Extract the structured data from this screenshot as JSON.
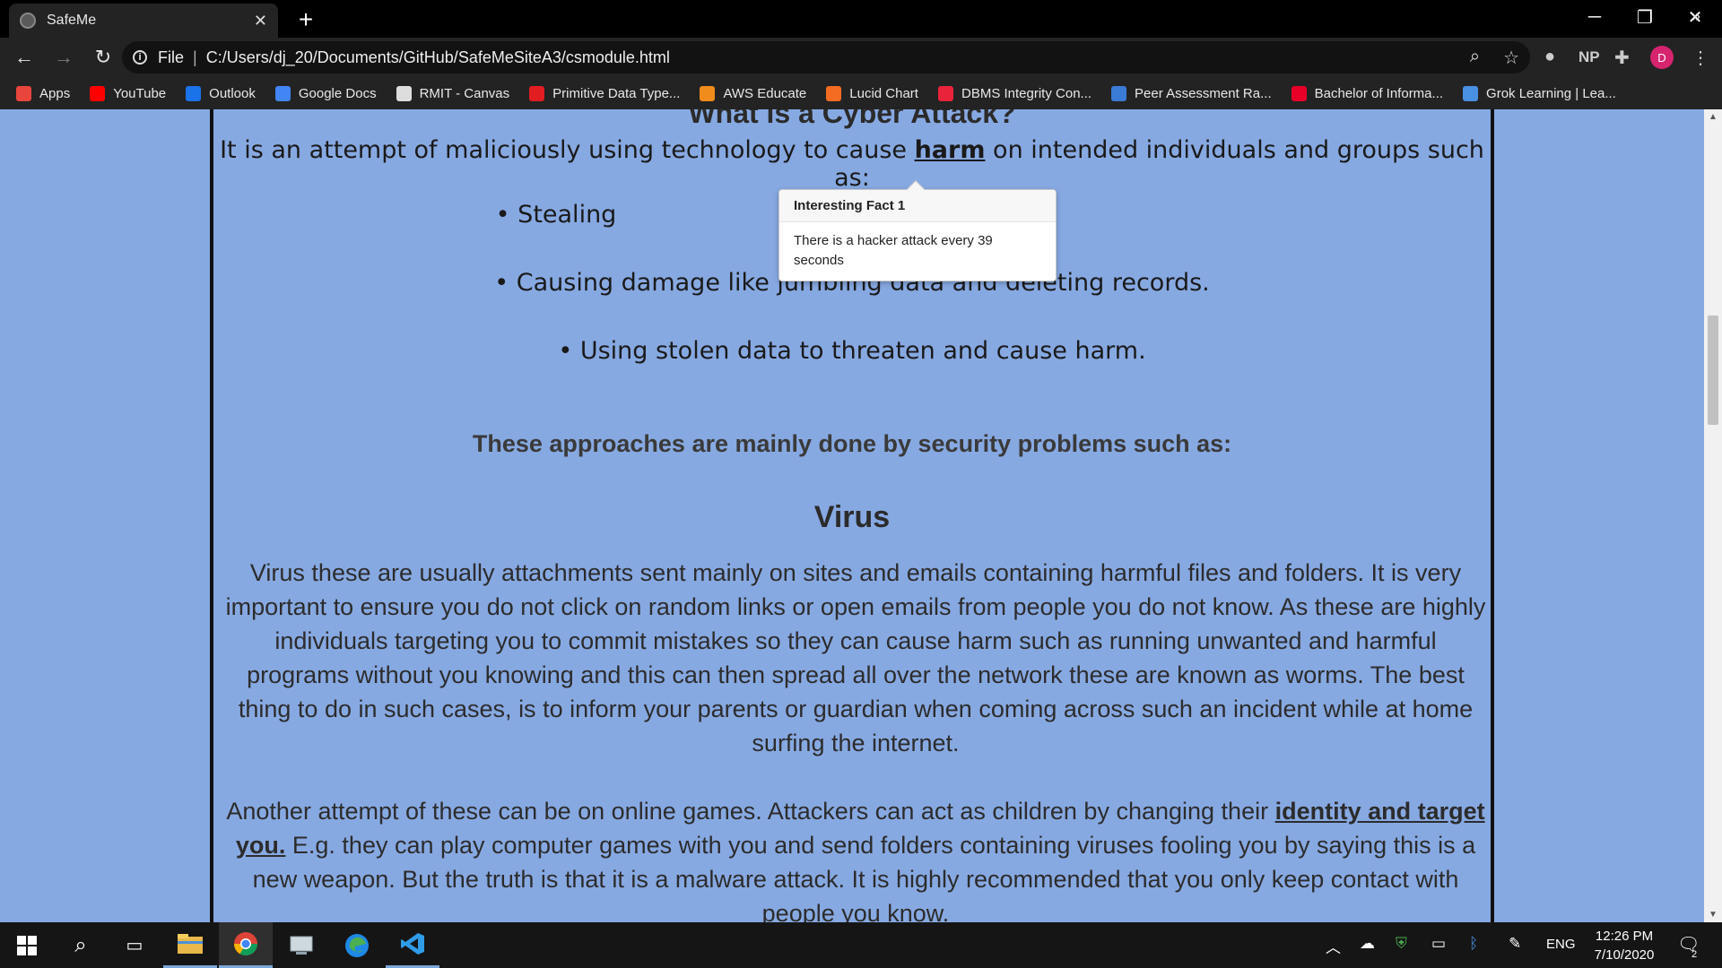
{
  "browser": {
    "tab_title": "SafeMe",
    "tab_close": "✕",
    "new_tab": "+",
    "window": {
      "minimize": "─",
      "restore": "❐",
      "close": "✕"
    },
    "address_scheme": "File",
    "address_url": "C:/Users/dj_20/Documents/GitHub/SafeMeSiteA3/csmodule.html",
    "profile_initial": "D",
    "extension_np": "NP",
    "bookmarks": [
      {
        "label": "Apps",
        "icon": "apps-grid-icon",
        "color": "#e8453c"
      },
      {
        "label": "YouTube",
        "icon": "youtube-icon",
        "color": "#ff0000"
      },
      {
        "label": "Outlook",
        "icon": "outlook-icon",
        "color": "#1a73e8"
      },
      {
        "label": "Google Docs",
        "icon": "google-docs-icon",
        "color": "#4285f4"
      },
      {
        "label": "RMIT - Canvas",
        "icon": "canvas-icon",
        "color": "#dddddd"
      },
      {
        "label": "Primitive Data Type...",
        "icon": "oracle-icon",
        "color": "#e11d21"
      },
      {
        "label": "AWS Educate",
        "icon": "aws-icon",
        "color": "#f08c1c"
      },
      {
        "label": "Lucid Chart",
        "icon": "lucidchart-icon",
        "color": "#f36c21"
      },
      {
        "label": "DBMS Integrity Con...",
        "icon": "dbms-icon",
        "color": "#e8233a"
      },
      {
        "label": "Peer Assessment Ra...",
        "icon": "peer-assessment-icon",
        "color": "#3a7bd5"
      },
      {
        "label": "Bachelor of Informa...",
        "icon": "rmit-icon",
        "color": "#e60028"
      },
      {
        "label": "Grok Learning | Lea...",
        "icon": "grok-icon",
        "color": "#4a90e2"
      }
    ],
    "bookmarks_more": "»"
  },
  "page": {
    "heading_clipped": "What is a Cyber Attack?",
    "lead_before": "It is an attempt of maliciously using technology to cause ",
    "lead_link": "harm",
    "lead_after": " on intended individuals and groups such as:",
    "bullets": [
      "• Stealing",
      "• Causing damage like jumbling data and deleting records.",
      "• Using stolen data to threaten and cause harm."
    ],
    "approaches": "These approaches are mainly done by security problems such as:",
    "virus_heading": "Virus",
    "virus_paragraph": "Virus these are usually attachments sent mainly on sites and emails containing harmful files and folders. It is very important to ensure you do not click on random links or open emails from people you do not know. As these are highly individuals targeting you to commit mistakes so they can cause harm such as running unwanted and harmful programs without you knowing and this can then spread all over the network these are known as worms. The best thing to do in such cases, is to inform your parents or guardian when coming across such an incident while at home surfing the internet.",
    "games_before": "Another attempt of these can be on online games. Attackers can act as children by changing their ",
    "games_link": "identity and target you.",
    "games_after": " E.g. they can play computer games with you and send folders containing viruses fooling you by saying this is a new weapon. But the truth is that it is a malware attack. It is highly recommended that you only keep contact with people you know.",
    "popover": {
      "title": "Interesting Fact 1",
      "body": "There is a hacker attack every 39 seconds"
    }
  },
  "taskbar": {
    "language": "ENG",
    "time": "12:26 PM",
    "date": "7/10/2020",
    "notification_count": "2"
  },
  "colors": {
    "page_background": "#87a9e2",
    "chrome_dark": "#232323",
    "panel_border": "#111111"
  }
}
